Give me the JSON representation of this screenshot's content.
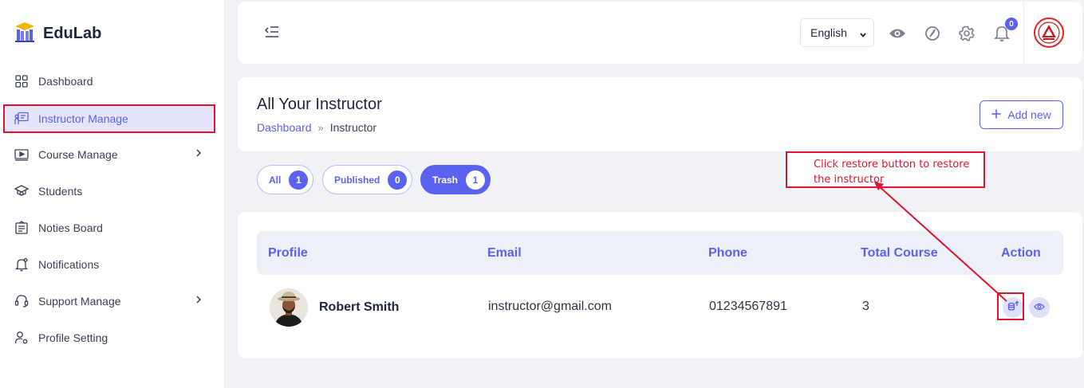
{
  "brand": {
    "name": "EduLab"
  },
  "sidebar": {
    "items": [
      {
        "label": "Dashboard",
        "icon": "grid-icon"
      },
      {
        "label": "Instructor Manage",
        "icon": "instructor-icon",
        "active": true
      },
      {
        "label": "Course Manage",
        "icon": "video-icon",
        "has_children": true
      },
      {
        "label": "Students",
        "icon": "graduation-cap-icon"
      },
      {
        "label": "Noties Board",
        "icon": "notice-board-icon"
      },
      {
        "label": "Notifications",
        "icon": "bell-icon"
      },
      {
        "label": "Support Manage",
        "icon": "headset-icon",
        "has_children": true
      },
      {
        "label": "Profile Setting",
        "icon": "user-settings-icon"
      }
    ]
  },
  "topbar": {
    "language": "English",
    "notification_count": "0",
    "icons": [
      "collapse-menu-icon",
      "eye-icon",
      "theme-toggle-icon",
      "gear-icon",
      "bell-icon"
    ]
  },
  "header": {
    "title": "All Your Instructor",
    "breadcrumb": {
      "root": "Dashboard",
      "separator": "»",
      "current": "Instructor"
    },
    "add_button": "Add new"
  },
  "filters": [
    {
      "label": "All",
      "count": "1"
    },
    {
      "label": "Published",
      "count": "0"
    },
    {
      "label": "Trash",
      "count": "1",
      "active": true
    }
  ],
  "table": {
    "columns": [
      "Profile",
      "Email",
      "Phone",
      "Total Course",
      "Action"
    ],
    "rows": [
      {
        "name": "Robert Smith",
        "email": "instructor@gmail.com",
        "phone": "01234567891",
        "total_course": "3"
      }
    ]
  },
  "annotation": {
    "text_line1": "Click restore button to  restore",
    "text_line2": "the instructor"
  },
  "colors": {
    "accent": "#5b62f0",
    "annotation": "#e0142f",
    "background": "#f1f2f6"
  }
}
